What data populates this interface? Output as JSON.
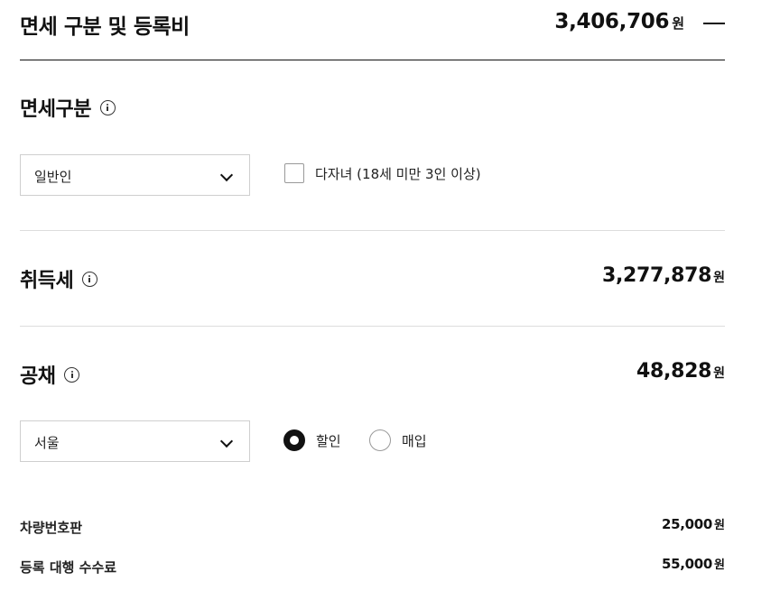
{
  "header": {
    "title": "면세 구분 및 등록비",
    "total_amount": "3,406,706",
    "unit": "원"
  },
  "exemption": {
    "title": "면세구분",
    "select_value": "일반인",
    "checkbox_label": "다자녀 (18세 미만 3인 이상)",
    "checkbox_checked": false
  },
  "acquisition_tax": {
    "title": "취득세",
    "amount": "3,277,878",
    "unit": "원"
  },
  "bond": {
    "title": "공채",
    "amount": "48,828",
    "unit": "원",
    "region_value": "서울",
    "options": [
      {
        "label": "할인",
        "selected": true
      },
      {
        "label": "매입",
        "selected": false
      }
    ]
  },
  "fees": [
    {
      "label": "차량번호판",
      "amount": "25,000",
      "unit": "원"
    },
    {
      "label": "등록 대행 수수료",
      "amount": "55,000",
      "unit": "원"
    }
  ]
}
